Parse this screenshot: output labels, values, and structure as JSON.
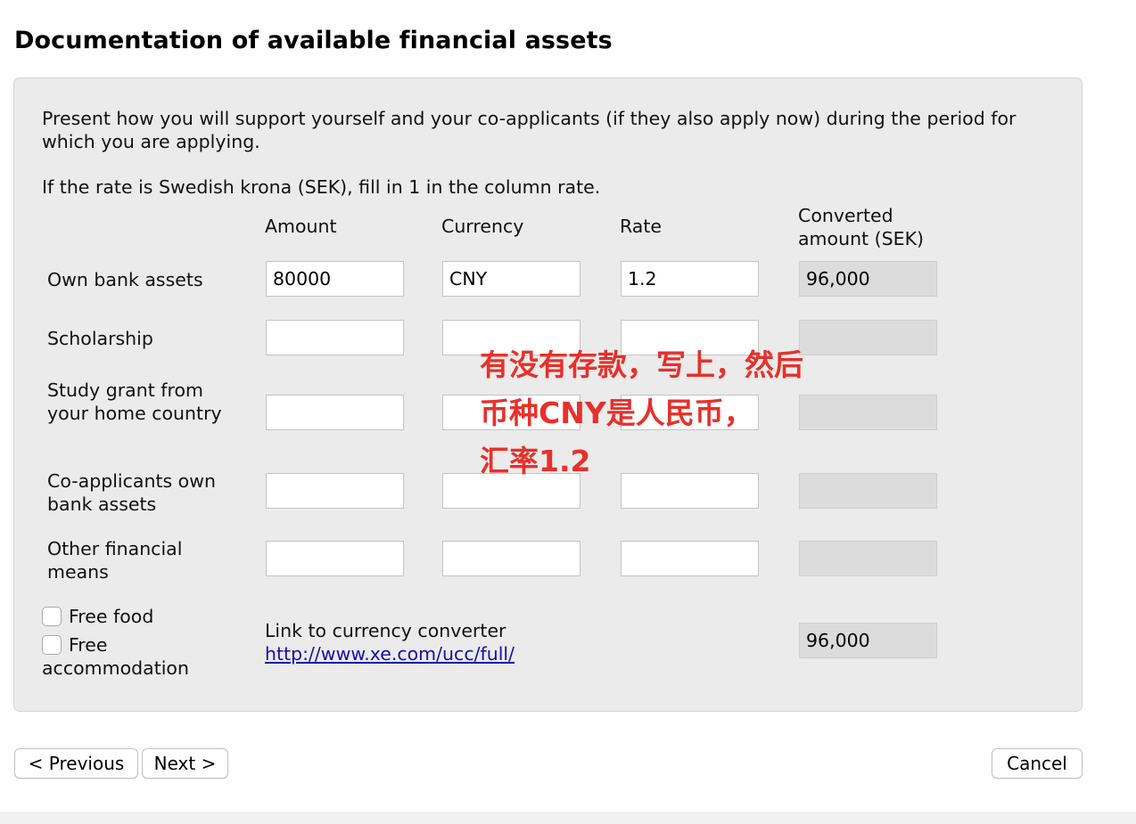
{
  "page_title": "Documentation of available financial assets",
  "intro": "Present how you will support yourself and your co-applicants (if they also apply now) during the period for which you are applying.",
  "rate_note": "If the rate is Swedish krona (SEK), fill in 1 in the column rate.",
  "columns": {
    "amount": "Amount",
    "currency": "Currency",
    "rate": "Rate",
    "converted_line1": "Converted",
    "converted_line2": "amount (SEK)"
  },
  "rows": [
    {
      "label": "Own bank assets",
      "amount": "80000",
      "currency": "CNY",
      "rate": "1.2",
      "converted": "96,000"
    },
    {
      "label": "Scholarship",
      "amount": "",
      "currency": "",
      "rate": "",
      "converted": ""
    },
    {
      "label": "Study grant from your home country",
      "amount": "",
      "currency": "",
      "rate": "",
      "converted": ""
    },
    {
      "label": "Co-applicants own bank assets",
      "amount": "",
      "currency": "",
      "rate": "",
      "converted": ""
    },
    {
      "label": "Other financial means",
      "amount": "",
      "currency": "",
      "rate": "",
      "converted": ""
    }
  ],
  "checkboxes": {
    "free_food": {
      "label": "Free food",
      "checked": false
    },
    "free_accommodation": {
      "label_line1": "Free",
      "label_line2": "accommodation",
      "checked": false
    }
  },
  "converter": {
    "label": "Link to currency converter",
    "url": "http://www.xe.com/ucc/full/"
  },
  "total_converted": "96,000",
  "annotation": {
    "line1": "有没有存款，写上，然后",
    "line2": "币种CNY是人民币，",
    "line3": "汇率1.2",
    "color": "#e8302a"
  },
  "buttons": {
    "previous": "< Previous",
    "next": "Next >",
    "cancel": "Cancel"
  },
  "colors": {
    "panel_bg": "#ebebeb",
    "readonly_field_bg": "#dcdcdc",
    "link": "#1a0dab"
  }
}
